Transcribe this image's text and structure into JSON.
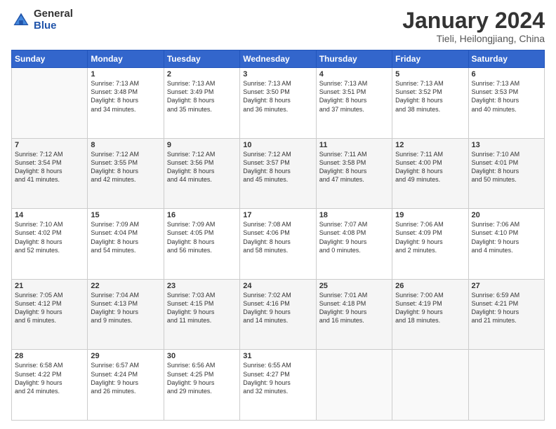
{
  "header": {
    "logo": {
      "general": "General",
      "blue": "Blue"
    },
    "title": "January 2024",
    "subtitle": "Tieli, Heilongjiang, China"
  },
  "calendar": {
    "days_of_week": [
      "Sunday",
      "Monday",
      "Tuesday",
      "Wednesday",
      "Thursday",
      "Friday",
      "Saturday"
    ],
    "weeks": [
      [
        {
          "day": "",
          "sunrise": "",
          "sunset": "",
          "daylight": ""
        },
        {
          "day": "1",
          "sunrise": "Sunrise: 7:13 AM",
          "sunset": "Sunset: 3:48 PM",
          "daylight": "Daylight: 8 hours and 34 minutes."
        },
        {
          "day": "2",
          "sunrise": "Sunrise: 7:13 AM",
          "sunset": "Sunset: 3:49 PM",
          "daylight": "Daylight: 8 hours and 35 minutes."
        },
        {
          "day": "3",
          "sunrise": "Sunrise: 7:13 AM",
          "sunset": "Sunset: 3:50 PM",
          "daylight": "Daylight: 8 hours and 36 minutes."
        },
        {
          "day": "4",
          "sunrise": "Sunrise: 7:13 AM",
          "sunset": "Sunset: 3:51 PM",
          "daylight": "Daylight: 8 hours and 37 minutes."
        },
        {
          "day": "5",
          "sunrise": "Sunrise: 7:13 AM",
          "sunset": "Sunset: 3:52 PM",
          "daylight": "Daylight: 8 hours and 38 minutes."
        },
        {
          "day": "6",
          "sunrise": "Sunrise: 7:13 AM",
          "sunset": "Sunset: 3:53 PM",
          "daylight": "Daylight: 8 hours and 40 minutes."
        }
      ],
      [
        {
          "day": "7",
          "sunrise": "Sunrise: 7:12 AM",
          "sunset": "Sunset: 3:54 PM",
          "daylight": "Daylight: 8 hours and 41 minutes."
        },
        {
          "day": "8",
          "sunrise": "Sunrise: 7:12 AM",
          "sunset": "Sunset: 3:55 PM",
          "daylight": "Daylight: 8 hours and 42 minutes."
        },
        {
          "day": "9",
          "sunrise": "Sunrise: 7:12 AM",
          "sunset": "Sunset: 3:56 PM",
          "daylight": "Daylight: 8 hours and 44 minutes."
        },
        {
          "day": "10",
          "sunrise": "Sunrise: 7:12 AM",
          "sunset": "Sunset: 3:57 PM",
          "daylight": "Daylight: 8 hours and 45 minutes."
        },
        {
          "day": "11",
          "sunrise": "Sunrise: 7:11 AM",
          "sunset": "Sunset: 3:58 PM",
          "daylight": "Daylight: 8 hours and 47 minutes."
        },
        {
          "day": "12",
          "sunrise": "Sunrise: 7:11 AM",
          "sunset": "Sunset: 4:00 PM",
          "daylight": "Daylight: 8 hours and 49 minutes."
        },
        {
          "day": "13",
          "sunrise": "Sunrise: 7:10 AM",
          "sunset": "Sunset: 4:01 PM",
          "daylight": "Daylight: 8 hours and 50 minutes."
        }
      ],
      [
        {
          "day": "14",
          "sunrise": "Sunrise: 7:10 AM",
          "sunset": "Sunset: 4:02 PM",
          "daylight": "Daylight: 8 hours and 52 minutes."
        },
        {
          "day": "15",
          "sunrise": "Sunrise: 7:09 AM",
          "sunset": "Sunset: 4:04 PM",
          "daylight": "Daylight: 8 hours and 54 minutes."
        },
        {
          "day": "16",
          "sunrise": "Sunrise: 7:09 AM",
          "sunset": "Sunset: 4:05 PM",
          "daylight": "Daylight: 8 hours and 56 minutes."
        },
        {
          "day": "17",
          "sunrise": "Sunrise: 7:08 AM",
          "sunset": "Sunset: 4:06 PM",
          "daylight": "Daylight: 8 hours and 58 minutes."
        },
        {
          "day": "18",
          "sunrise": "Sunrise: 7:07 AM",
          "sunset": "Sunset: 4:08 PM",
          "daylight": "Daylight: 9 hours and 0 minutes."
        },
        {
          "day": "19",
          "sunrise": "Sunrise: 7:06 AM",
          "sunset": "Sunset: 4:09 PM",
          "daylight": "Daylight: 9 hours and 2 minutes."
        },
        {
          "day": "20",
          "sunrise": "Sunrise: 7:06 AM",
          "sunset": "Sunset: 4:10 PM",
          "daylight": "Daylight: 9 hours and 4 minutes."
        }
      ],
      [
        {
          "day": "21",
          "sunrise": "Sunrise: 7:05 AM",
          "sunset": "Sunset: 4:12 PM",
          "daylight": "Daylight: 9 hours and 6 minutes."
        },
        {
          "day": "22",
          "sunrise": "Sunrise: 7:04 AM",
          "sunset": "Sunset: 4:13 PM",
          "daylight": "Daylight: 9 hours and 9 minutes."
        },
        {
          "day": "23",
          "sunrise": "Sunrise: 7:03 AM",
          "sunset": "Sunset: 4:15 PM",
          "daylight": "Daylight: 9 hours and 11 minutes."
        },
        {
          "day": "24",
          "sunrise": "Sunrise: 7:02 AM",
          "sunset": "Sunset: 4:16 PM",
          "daylight": "Daylight: 9 hours and 14 minutes."
        },
        {
          "day": "25",
          "sunrise": "Sunrise: 7:01 AM",
          "sunset": "Sunset: 4:18 PM",
          "daylight": "Daylight: 9 hours and 16 minutes."
        },
        {
          "day": "26",
          "sunrise": "Sunrise: 7:00 AM",
          "sunset": "Sunset: 4:19 PM",
          "daylight": "Daylight: 9 hours and 18 minutes."
        },
        {
          "day": "27",
          "sunrise": "Sunrise: 6:59 AM",
          "sunset": "Sunset: 4:21 PM",
          "daylight": "Daylight: 9 hours and 21 minutes."
        }
      ],
      [
        {
          "day": "28",
          "sunrise": "Sunrise: 6:58 AM",
          "sunset": "Sunset: 4:22 PM",
          "daylight": "Daylight: 9 hours and 24 minutes."
        },
        {
          "day": "29",
          "sunrise": "Sunrise: 6:57 AM",
          "sunset": "Sunset: 4:24 PM",
          "daylight": "Daylight: 9 hours and 26 minutes."
        },
        {
          "day": "30",
          "sunrise": "Sunrise: 6:56 AM",
          "sunset": "Sunset: 4:25 PM",
          "daylight": "Daylight: 9 hours and 29 minutes."
        },
        {
          "day": "31",
          "sunrise": "Sunrise: 6:55 AM",
          "sunset": "Sunset: 4:27 PM",
          "daylight": "Daylight: 9 hours and 32 minutes."
        },
        {
          "day": "",
          "sunrise": "",
          "sunset": "",
          "daylight": ""
        },
        {
          "day": "",
          "sunrise": "",
          "sunset": "",
          "daylight": ""
        },
        {
          "day": "",
          "sunrise": "",
          "sunset": "",
          "daylight": ""
        }
      ]
    ]
  }
}
